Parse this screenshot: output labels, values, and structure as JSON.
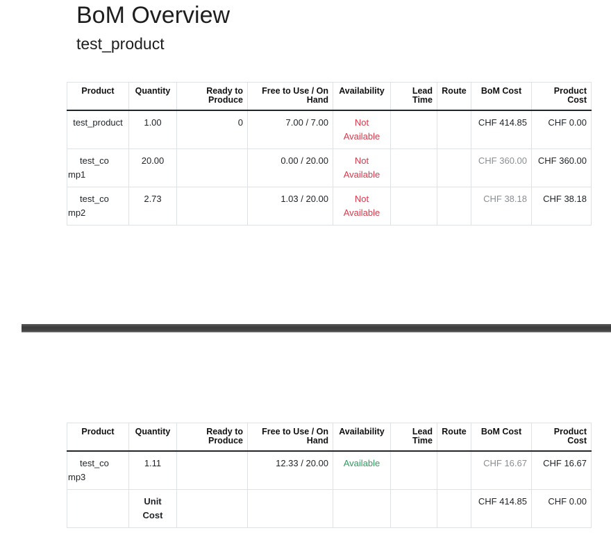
{
  "header": {
    "title": "BoM Overview",
    "product": "test_product"
  },
  "columns": [
    "Product",
    "Quantity",
    "Ready to Produce",
    "Free to Use / On Hand",
    "Availability",
    "Lead Time",
    "Route",
    "BoM Cost",
    "Product Cost"
  ],
  "table1": {
    "rows": [
      {
        "product": "test_product",
        "quantity": "1.00",
        "ready": "0",
        "free": "7.00 / 7.00",
        "availability": "Not Available",
        "lead": "",
        "route": "",
        "bom_cost": "CHF 414.85",
        "product_cost": "CHF 0.00"
      },
      {
        "product": "test_comp1",
        "quantity": "20.00",
        "ready": "",
        "free": "0.00 / 20.00",
        "availability": "Not Available",
        "lead": "",
        "route": "",
        "bom_cost": "CHF 360.00",
        "product_cost": "CHF 360.00"
      },
      {
        "product": "test_comp2",
        "quantity": "2.73",
        "ready": "",
        "free": "1.03 / 20.00",
        "availability": "Not Available",
        "lead": "",
        "route": "",
        "bom_cost": "CHF 38.18",
        "product_cost": "CHF 38.18"
      }
    ]
  },
  "table2": {
    "rows": [
      {
        "product": "test_comp3",
        "quantity": "1.11",
        "ready": "",
        "free": "12.33 / 20.00",
        "availability": "Available",
        "lead": "",
        "route": "",
        "bom_cost": "CHF 16.67",
        "product_cost": "CHF 16.67"
      }
    ],
    "unit_cost": {
      "label": "Unit Cost",
      "bom_cost": "CHF 414.85",
      "product_cost": "CHF 0.00"
    }
  },
  "colors": {
    "not_available": "#d9374a",
    "available": "#2e9b5d",
    "muted": "#8a8f94"
  }
}
